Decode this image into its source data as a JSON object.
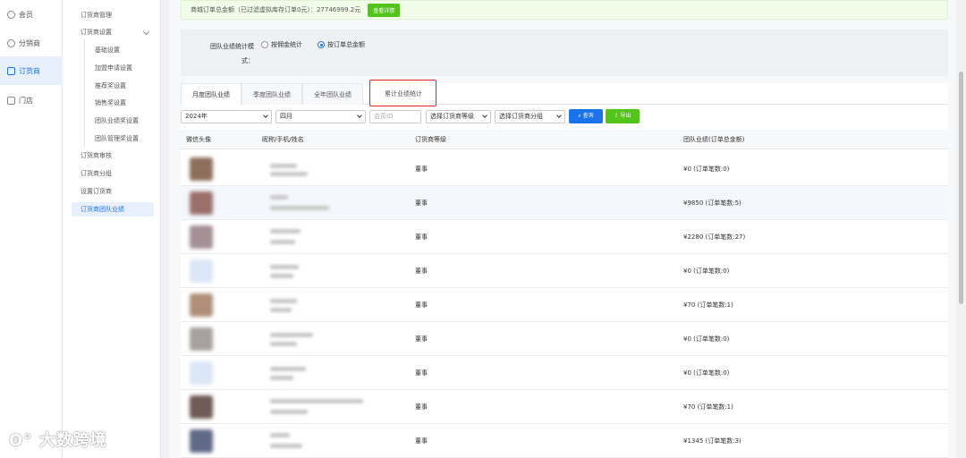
{
  "nav1": [
    {
      "label": "会员",
      "icon": "user-icon",
      "active": false
    },
    {
      "label": "分销商",
      "icon": "people-icon",
      "active": false
    },
    {
      "label": "订货商",
      "icon": "order-icon",
      "active": true
    },
    {
      "label": "门店",
      "icon": "store-icon",
      "active": false
    }
  ],
  "nav2": {
    "manage": "订货商管理",
    "settings": "订货商设置",
    "sub": [
      "基础设置",
      "加盟申请设置",
      "推荐奖设置",
      "销售奖设置",
      "团队业绩奖设置",
      "团队管理奖设置"
    ],
    "audit": "订货商审核",
    "group": "订货商分组",
    "set": "设置订货商",
    "team": "订货商团队业绩"
  },
  "alert": {
    "text": "商城订单总金额（已过滤虚拟库存订单0元）：27746999.2元",
    "button": "查看详情"
  },
  "mode": {
    "label": "团队业绩统计模式：",
    "option1": "按佣金统计",
    "option2": "按订单总金额"
  },
  "tabs": [
    "月度团队业绩",
    "季度团队业绩",
    "全年团队业绩",
    "累计业绩统计"
  ],
  "filters": {
    "year": "2024年",
    "month": "四月",
    "member_placeholder": "会员ID",
    "level": "选择订货商等级",
    "group": "选择订货商分组",
    "search": "查询",
    "export": "导出"
  },
  "table": {
    "headers": [
      "微信头像",
      "昵称/手机/姓名",
      "订货商等级",
      "团队业绩(订单总金额)"
    ],
    "rows": [
      {
        "level": "董事",
        "amount": "¥0 (订单笔数:0)"
      },
      {
        "level": "董事",
        "amount": "¥9850 (订单笔数:5)"
      },
      {
        "level": "董事",
        "amount": "¥2280 (订单笔数:27)"
      },
      {
        "level": "董事",
        "amount": "¥0 (订单笔数:0)"
      },
      {
        "level": "董事",
        "amount": "¥70 (订单笔数:1)"
      },
      {
        "level": "董事",
        "amount": "¥0 (订单笔数:0)"
      },
      {
        "level": "董事",
        "amount": "¥0 (订单笔数:0)"
      },
      {
        "level": "董事",
        "amount": "¥70 (订单笔数:1)"
      },
      {
        "level": "董事",
        "amount": "¥1345 (订单笔数:3)"
      }
    ]
  },
  "watermark": "大数跨境",
  "colors": {
    "accent": "#1a73e8",
    "success": "#52c41a",
    "highlight": "#e02424"
  }
}
